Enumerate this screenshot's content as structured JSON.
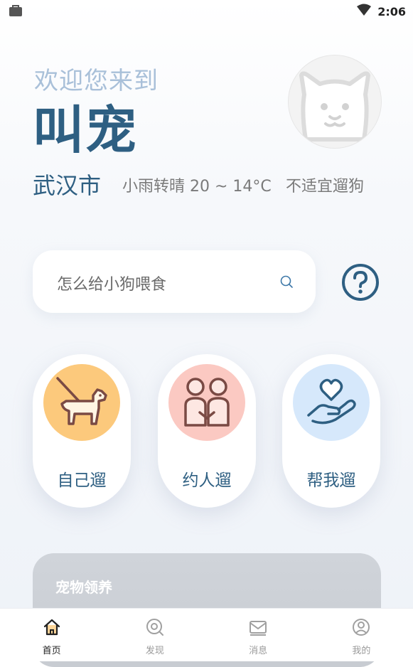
{
  "status_bar": {
    "time": "2:06",
    "left_icon": "bag-icon",
    "right_icon": "wifi-icon"
  },
  "header": {
    "greeting": "欢迎您来到",
    "title": "叫宠",
    "avatar_icon": "dog-face-icon"
  },
  "weather": {
    "city": "武汉市",
    "condition": "小雨转晴 20 ~ 14°C",
    "advice": "不适宜遛狗"
  },
  "search": {
    "placeholder": "怎么给小狗喂食",
    "icon": "search-icon",
    "help_icon": "question-circle-icon"
  },
  "actions": [
    {
      "label": "自己遛",
      "icon": "dog-leash-icon",
      "color": "#fcc97c"
    },
    {
      "label": "约人遛",
      "icon": "couple-icon",
      "color": "#fbc9c2"
    },
    {
      "label": "帮我遛",
      "icon": "heart-hand-icon",
      "color": "#d6e8fb"
    }
  ],
  "adopt_card": {
    "title": "宠物领养"
  },
  "bottom_nav": [
    {
      "label": "首页",
      "icon": "home-icon",
      "active": true
    },
    {
      "label": "发现",
      "icon": "discover-icon",
      "active": false
    },
    {
      "label": "消息",
      "icon": "mail-icon",
      "active": false
    },
    {
      "label": "我的",
      "icon": "profile-icon",
      "active": false
    }
  ],
  "colors": {
    "accent": "#2e5f82",
    "greeting": "#a9c0d9",
    "text_gray": "#7a7a7a"
  }
}
